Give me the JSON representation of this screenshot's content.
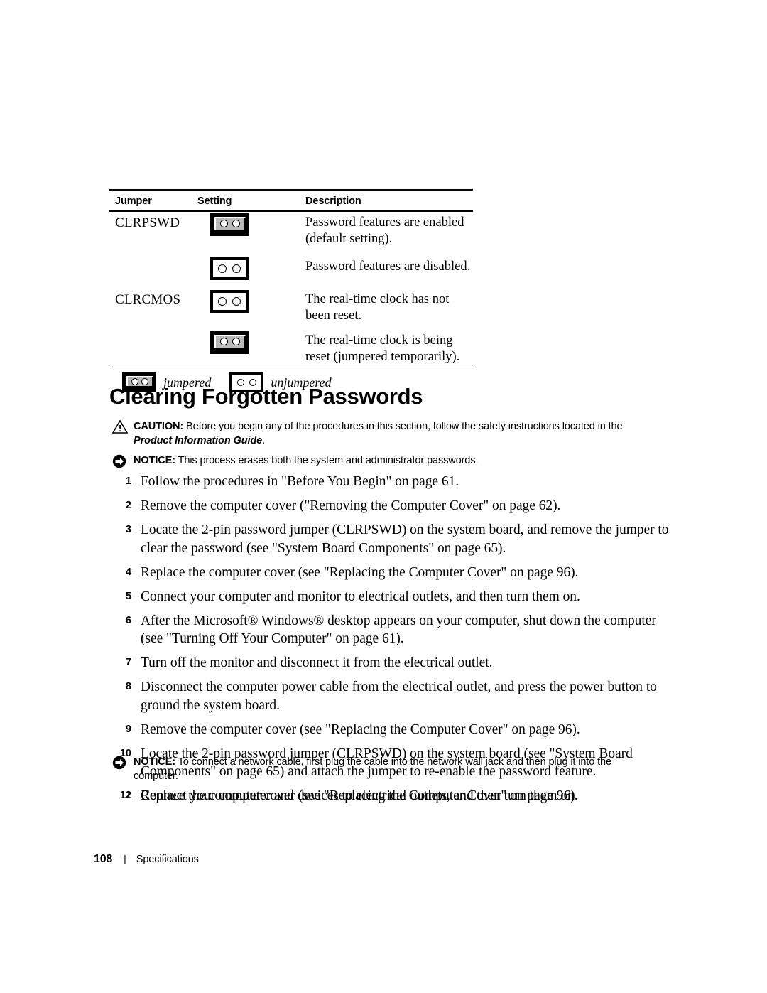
{
  "table": {
    "columns": [
      "Jumper",
      "Setting",
      "Description"
    ],
    "rows": [
      {
        "jumper": "CLRPSWD",
        "setting": "jumpered",
        "description": "Password features are enabled (default setting)."
      },
      {
        "jumper": "",
        "setting": "unjumpered",
        "description": "Password features are disabled."
      },
      {
        "jumper": "CLRCMOS",
        "setting": "unjumpered",
        "description": "The real-time clock has not been reset."
      },
      {
        "jumper": "",
        "setting": "jumpered",
        "description": "The real-time clock is being reset (jumpered temporarily)."
      }
    ],
    "legend": [
      {
        "icon": "jumpered",
        "label": "jumpered"
      },
      {
        "icon": "unjumpered",
        "label": "unjumpered"
      }
    ]
  },
  "heading": "Clearing Forgotten Passwords",
  "caution": {
    "label": "CAUTION:",
    "text": " Before you begin any of the procedures in this section, follow the safety instructions located in the ",
    "reference": "Product Information Guide",
    "end": "."
  },
  "notice1": {
    "label": "NOTICE:",
    "text": " This process erases both the system and administrator passwords."
  },
  "notice2": {
    "label": "NOTICE:",
    "text": " To connect a network cable, first plug the cable into the network wall jack and then plug it into the computer."
  },
  "steps_part1": [
    {
      "num": "1",
      "text": "Follow the procedures in \"Before You Begin\" on page 61."
    },
    {
      "num": "2",
      "text": "Remove the computer cover (\"Removing the Computer Cover\" on page 62)."
    },
    {
      "num": "3",
      "text": "Locate the 2-pin password jumper (CLRPSWD) on the system board, and remove the jumper to clear the password (see \"System Board Components\" on page 65)."
    },
    {
      "num": "4",
      "text": "Replace the computer cover (see \"Replacing the Computer Cover\" on page 96)."
    },
    {
      "num": "5",
      "text": "Connect your computer and monitor to electrical outlets, and then turn them on."
    },
    {
      "num": "6",
      "text": "After the Microsoft® Windows® desktop appears on your computer, shut down the computer (see \"Turning Off Your Computer\" on page 61)."
    },
    {
      "num": "7",
      "text": "Turn off the monitor and disconnect it from the electrical outlet."
    },
    {
      "num": "8",
      "text": "Disconnect the computer power cable from the electrical outlet, and press the power button to ground the system board."
    },
    {
      "num": "9",
      "text": "Remove the computer cover (see \"Replacing the Computer Cover\" on page 96)."
    },
    {
      "num": "10",
      "text": "Locate the 2-pin password jumper (CLRPSWD) on the system board (see \"System Board Components\" on page 65) and attach the jumper to re-enable the password feature."
    },
    {
      "num": "11",
      "text": "Replace the computer cover (see \"Replacing the Computer Cover\" on page 96)."
    }
  ],
  "steps_part2": [
    {
      "num": "12",
      "text": "Connect your computer and devices to electrical outlets, and then turn them on."
    }
  ],
  "footer": {
    "page": "108",
    "separator": "|",
    "section": "Specifications"
  }
}
